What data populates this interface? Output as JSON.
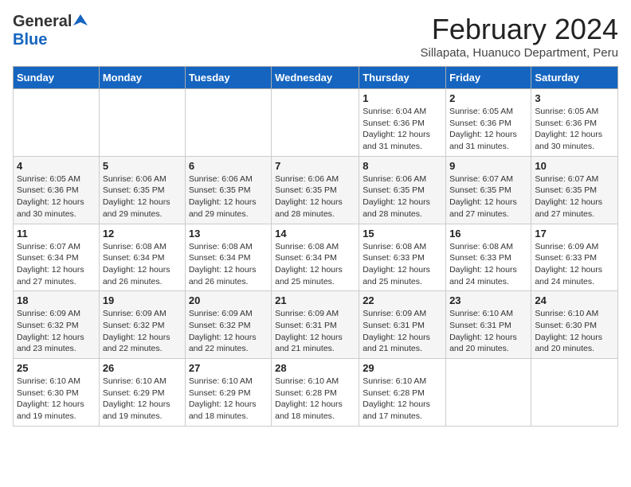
{
  "header": {
    "logo_general": "General",
    "logo_blue": "Blue",
    "month_title": "February 2024",
    "location": "Sillapata, Huanuco Department, Peru"
  },
  "weekdays": [
    "Sunday",
    "Monday",
    "Tuesday",
    "Wednesday",
    "Thursday",
    "Friday",
    "Saturday"
  ],
  "weeks": [
    [
      {
        "day": "",
        "info": ""
      },
      {
        "day": "",
        "info": ""
      },
      {
        "day": "",
        "info": ""
      },
      {
        "day": "",
        "info": ""
      },
      {
        "day": "1",
        "info": "Sunrise: 6:04 AM\nSunset: 6:36 PM\nDaylight: 12 hours\nand 31 minutes."
      },
      {
        "day": "2",
        "info": "Sunrise: 6:05 AM\nSunset: 6:36 PM\nDaylight: 12 hours\nand 31 minutes."
      },
      {
        "day": "3",
        "info": "Sunrise: 6:05 AM\nSunset: 6:36 PM\nDaylight: 12 hours\nand 30 minutes."
      }
    ],
    [
      {
        "day": "4",
        "info": "Sunrise: 6:05 AM\nSunset: 6:36 PM\nDaylight: 12 hours\nand 30 minutes."
      },
      {
        "day": "5",
        "info": "Sunrise: 6:06 AM\nSunset: 6:35 PM\nDaylight: 12 hours\nand 29 minutes."
      },
      {
        "day": "6",
        "info": "Sunrise: 6:06 AM\nSunset: 6:35 PM\nDaylight: 12 hours\nand 29 minutes."
      },
      {
        "day": "7",
        "info": "Sunrise: 6:06 AM\nSunset: 6:35 PM\nDaylight: 12 hours\nand 28 minutes."
      },
      {
        "day": "8",
        "info": "Sunrise: 6:06 AM\nSunset: 6:35 PM\nDaylight: 12 hours\nand 28 minutes."
      },
      {
        "day": "9",
        "info": "Sunrise: 6:07 AM\nSunset: 6:35 PM\nDaylight: 12 hours\nand 27 minutes."
      },
      {
        "day": "10",
        "info": "Sunrise: 6:07 AM\nSunset: 6:35 PM\nDaylight: 12 hours\nand 27 minutes."
      }
    ],
    [
      {
        "day": "11",
        "info": "Sunrise: 6:07 AM\nSunset: 6:34 PM\nDaylight: 12 hours\nand 27 minutes."
      },
      {
        "day": "12",
        "info": "Sunrise: 6:08 AM\nSunset: 6:34 PM\nDaylight: 12 hours\nand 26 minutes."
      },
      {
        "day": "13",
        "info": "Sunrise: 6:08 AM\nSunset: 6:34 PM\nDaylight: 12 hours\nand 26 minutes."
      },
      {
        "day": "14",
        "info": "Sunrise: 6:08 AM\nSunset: 6:34 PM\nDaylight: 12 hours\nand 25 minutes."
      },
      {
        "day": "15",
        "info": "Sunrise: 6:08 AM\nSunset: 6:33 PM\nDaylight: 12 hours\nand 25 minutes."
      },
      {
        "day": "16",
        "info": "Sunrise: 6:08 AM\nSunset: 6:33 PM\nDaylight: 12 hours\nand 24 minutes."
      },
      {
        "day": "17",
        "info": "Sunrise: 6:09 AM\nSunset: 6:33 PM\nDaylight: 12 hours\nand 24 minutes."
      }
    ],
    [
      {
        "day": "18",
        "info": "Sunrise: 6:09 AM\nSunset: 6:32 PM\nDaylight: 12 hours\nand 23 minutes."
      },
      {
        "day": "19",
        "info": "Sunrise: 6:09 AM\nSunset: 6:32 PM\nDaylight: 12 hours\nand 22 minutes."
      },
      {
        "day": "20",
        "info": "Sunrise: 6:09 AM\nSunset: 6:32 PM\nDaylight: 12 hours\nand 22 minutes."
      },
      {
        "day": "21",
        "info": "Sunrise: 6:09 AM\nSunset: 6:31 PM\nDaylight: 12 hours\nand 21 minutes."
      },
      {
        "day": "22",
        "info": "Sunrise: 6:09 AM\nSunset: 6:31 PM\nDaylight: 12 hours\nand 21 minutes."
      },
      {
        "day": "23",
        "info": "Sunrise: 6:10 AM\nSunset: 6:31 PM\nDaylight: 12 hours\nand 20 minutes."
      },
      {
        "day": "24",
        "info": "Sunrise: 6:10 AM\nSunset: 6:30 PM\nDaylight: 12 hours\nand 20 minutes."
      }
    ],
    [
      {
        "day": "25",
        "info": "Sunrise: 6:10 AM\nSunset: 6:30 PM\nDaylight: 12 hours\nand 19 minutes."
      },
      {
        "day": "26",
        "info": "Sunrise: 6:10 AM\nSunset: 6:29 PM\nDaylight: 12 hours\nand 19 minutes."
      },
      {
        "day": "27",
        "info": "Sunrise: 6:10 AM\nSunset: 6:29 PM\nDaylight: 12 hours\nand 18 minutes."
      },
      {
        "day": "28",
        "info": "Sunrise: 6:10 AM\nSunset: 6:28 PM\nDaylight: 12 hours\nand 18 minutes."
      },
      {
        "day": "29",
        "info": "Sunrise: 6:10 AM\nSunset: 6:28 PM\nDaylight: 12 hours\nand 17 minutes."
      },
      {
        "day": "",
        "info": ""
      },
      {
        "day": "",
        "info": ""
      }
    ]
  ]
}
